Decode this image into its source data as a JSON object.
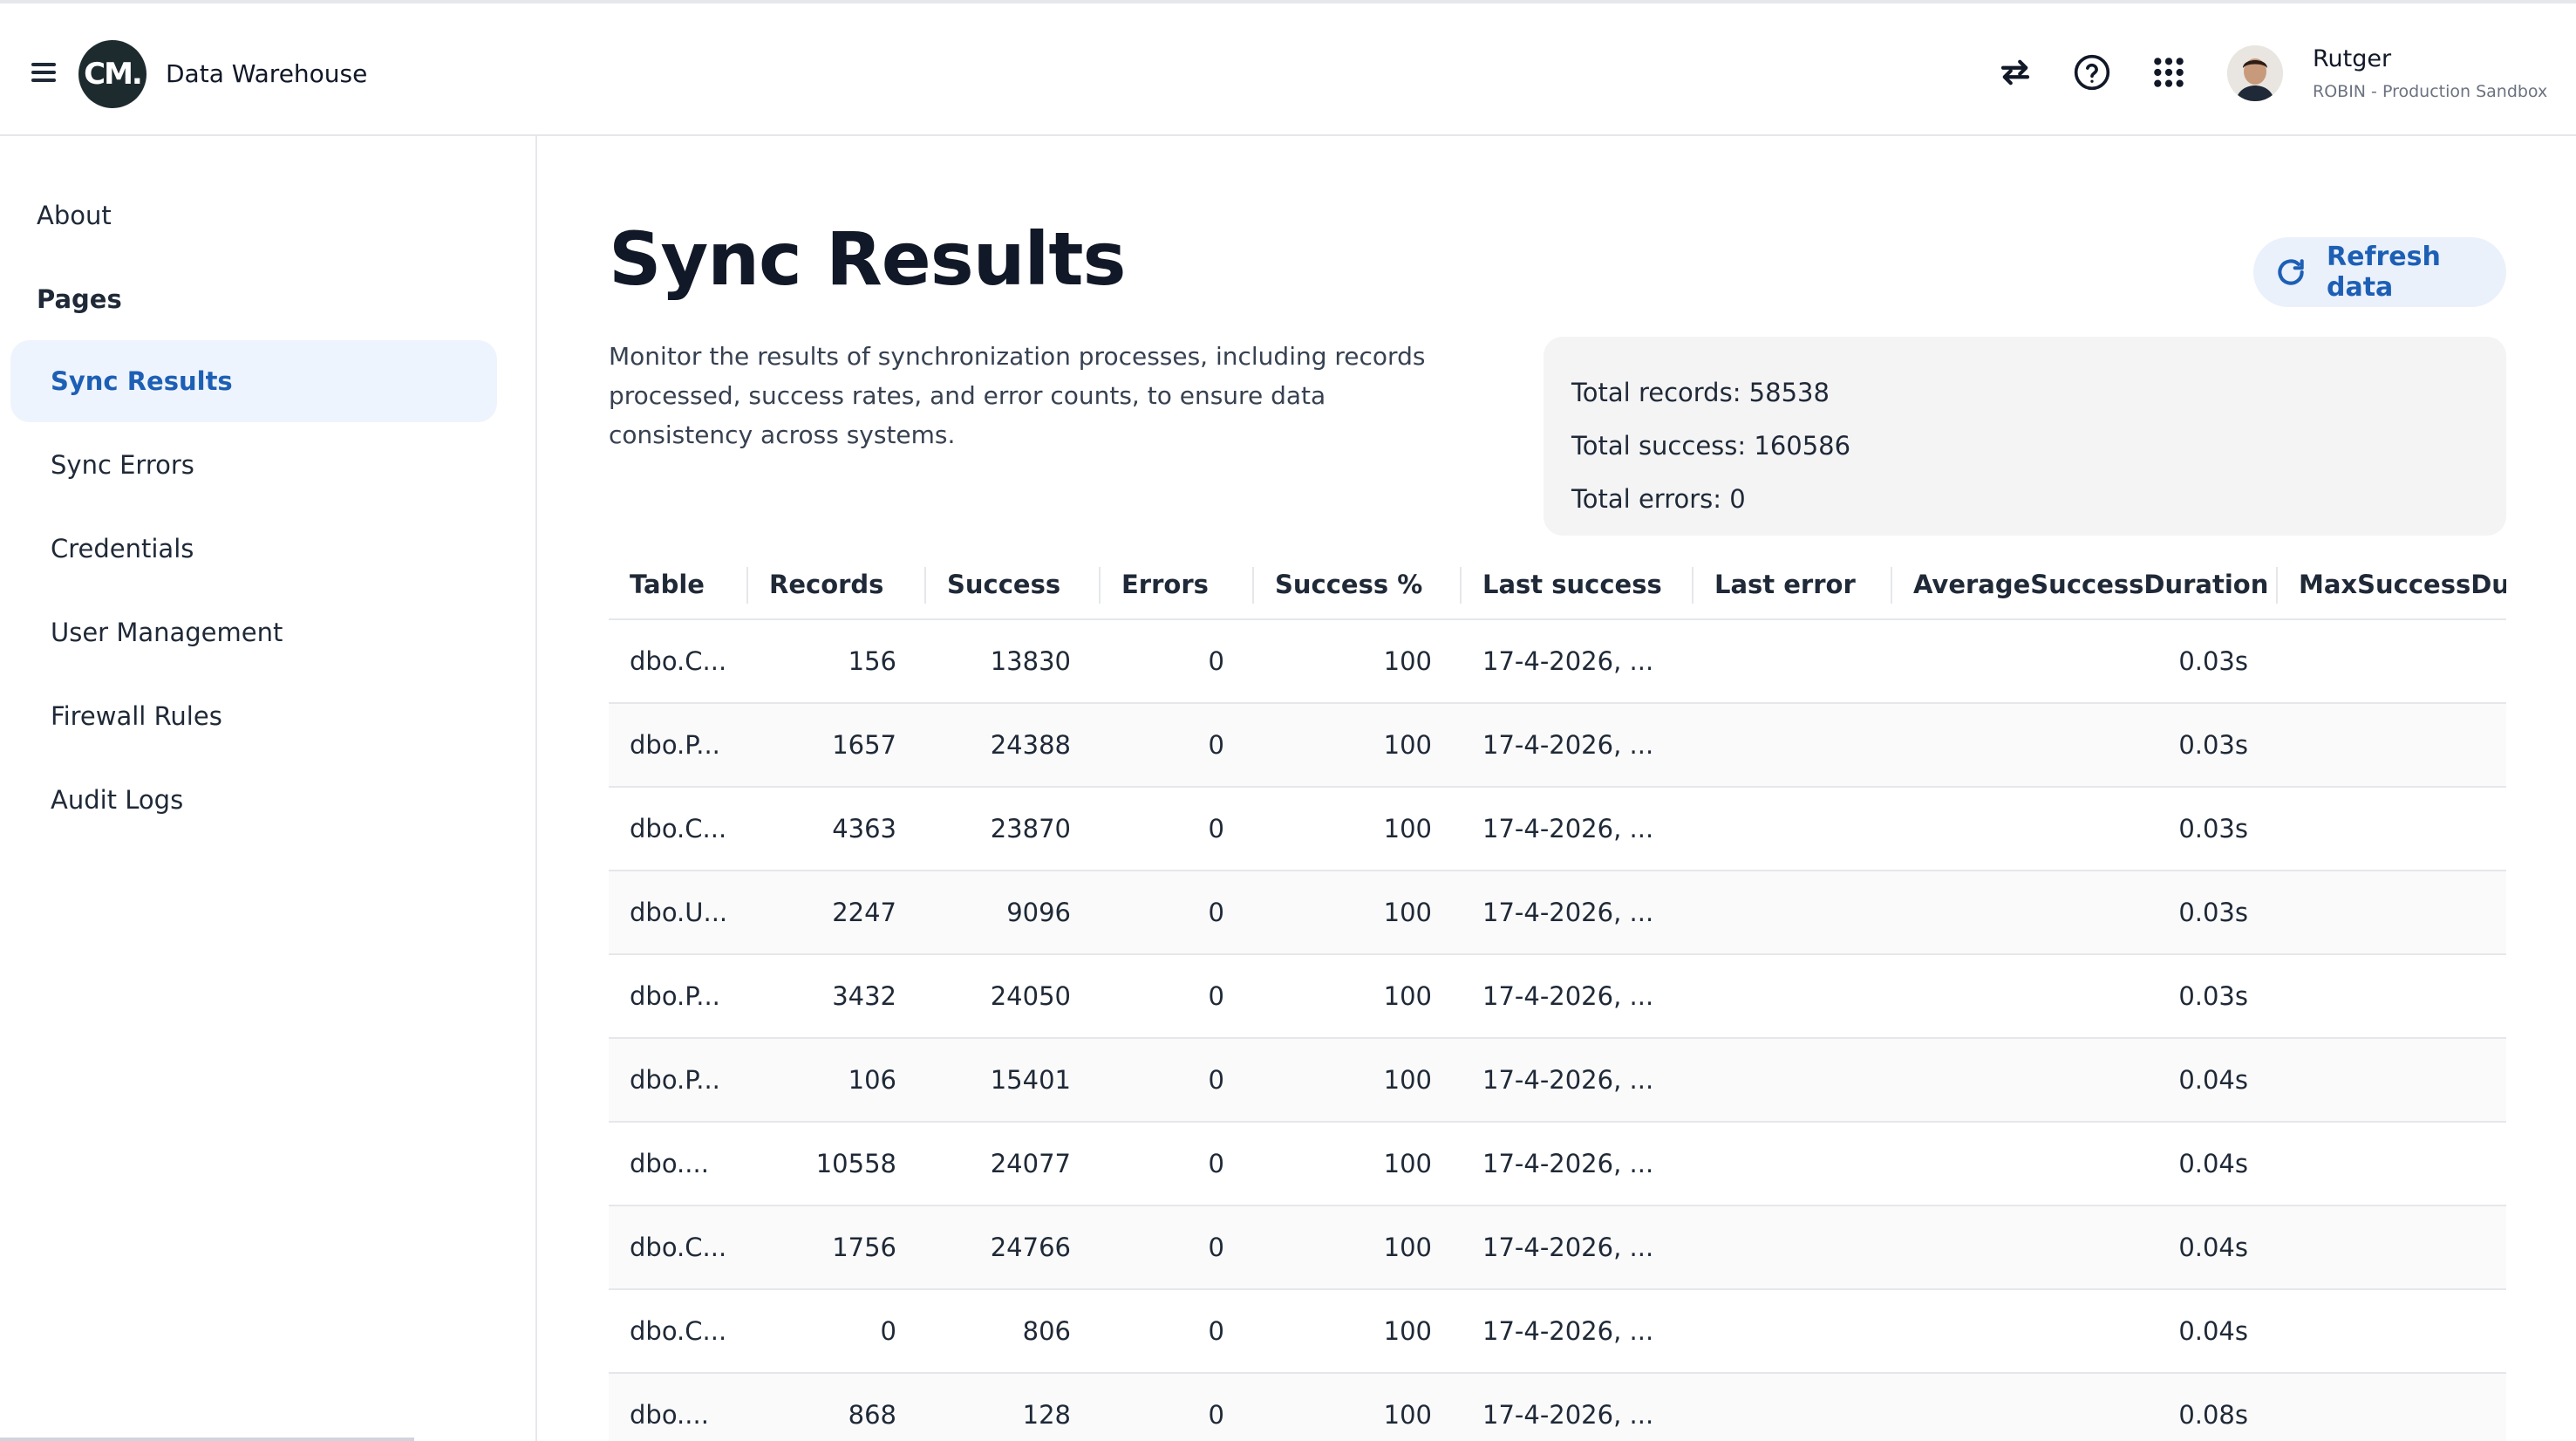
{
  "header": {
    "app_title": "Data Warehouse",
    "logo_text": "CM.",
    "icons": [
      "menu-icon",
      "switch-icon",
      "help-icon",
      "apps-grid-icon"
    ],
    "user": {
      "name": "Rutger",
      "environment": "ROBIN - Production Sandbox"
    }
  },
  "sidebar": {
    "about": "About",
    "section_label": "Pages",
    "items": [
      {
        "label": "Sync Results",
        "active": true
      },
      {
        "label": "Sync Errors",
        "active": false
      },
      {
        "label": "Credentials",
        "active": false
      },
      {
        "label": "User Management",
        "active": false
      },
      {
        "label": "Firewall Rules",
        "active": false
      },
      {
        "label": "Audit Logs",
        "active": false
      }
    ]
  },
  "main": {
    "title": "Sync Results",
    "refresh_label": "Refresh data",
    "description": "Monitor the results of synchronization processes, including records processed, success rates, and error counts, to ensure data consistency across systems.",
    "totals": {
      "records": "Total records: 58538",
      "success": "Total success: 160586",
      "errors": "Total errors: 0"
    }
  },
  "table": {
    "columns": [
      "Table",
      "Records",
      "Success",
      "Errors",
      "Success %",
      "Last success",
      "Last error",
      "AverageSuccessDuration",
      "MaxSuccessDura"
    ],
    "rows": [
      [
        "dbo.C...",
        "156",
        "13830",
        "0",
        "100",
        "17-4-2026, ...",
        "",
        "0.03s",
        ""
      ],
      [
        "dbo.P...",
        "1657",
        "24388",
        "0",
        "100",
        "17-4-2026, ...",
        "",
        "0.03s",
        ""
      ],
      [
        "dbo.C...",
        "4363",
        "23870",
        "0",
        "100",
        "17-4-2026, ...",
        "",
        "0.03s",
        ""
      ],
      [
        "dbo.U...",
        "2247",
        "9096",
        "0",
        "100",
        "17-4-2026, ...",
        "",
        "0.03s",
        ""
      ],
      [
        "dbo.P...",
        "3432",
        "24050",
        "0",
        "100",
        "17-4-2026, ...",
        "",
        "0.03s",
        ""
      ],
      [
        "dbo.P...",
        "106",
        "15401",
        "0",
        "100",
        "17-4-2026, ...",
        "",
        "0.04s",
        ""
      ],
      [
        "dbo....",
        "10558",
        "24077",
        "0",
        "100",
        "17-4-2026, ...",
        "",
        "0.04s",
        ""
      ],
      [
        "dbo.C...",
        "1756",
        "24766",
        "0",
        "100",
        "17-4-2026, ...",
        "",
        "0.04s",
        ""
      ],
      [
        "dbo.C...",
        "0",
        "806",
        "0",
        "100",
        "17-4-2026, ...",
        "",
        "0.04s",
        ""
      ],
      [
        "dbo....",
        "868",
        "128",
        "0",
        "100",
        "17-4-2026, ...",
        "",
        "0.08s",
        ""
      ]
    ]
  },
  "colors": {
    "accent": "#1d5fb5",
    "active_bg": "#eef4fd",
    "totals_bg": "#f4f4f5"
  }
}
